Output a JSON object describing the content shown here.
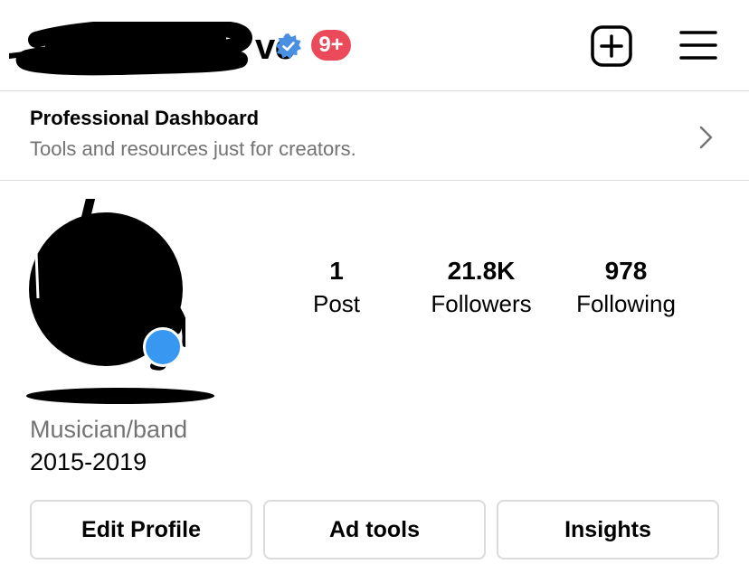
{
  "header": {
    "username_visible_fragment": "ve",
    "verified_icon": "verified-badge-icon",
    "notification_badge": "9+",
    "new_post_icon": "plus-square-icon",
    "menu_icon": "hamburger-menu-icon",
    "colors": {
      "verified": "#4a90e2",
      "badge": "#ea4a5a"
    }
  },
  "dashboard": {
    "title": "Professional Dashboard",
    "subtitle": "Tools and resources just for creators.",
    "chevron_icon": "chevron-right-icon"
  },
  "profile": {
    "stats": [
      {
        "value": "1",
        "label": "Post"
      },
      {
        "value": "21.8K",
        "label": "Followers"
      },
      {
        "value": "978",
        "label": "Following"
      }
    ],
    "category": "Musician/band",
    "bio": "2015-2019",
    "add_story_color": "#3897f0"
  },
  "actions": {
    "buttons": [
      {
        "label": "Edit Profile"
      },
      {
        "label": "Ad tools"
      },
      {
        "label": "Insights"
      }
    ]
  }
}
